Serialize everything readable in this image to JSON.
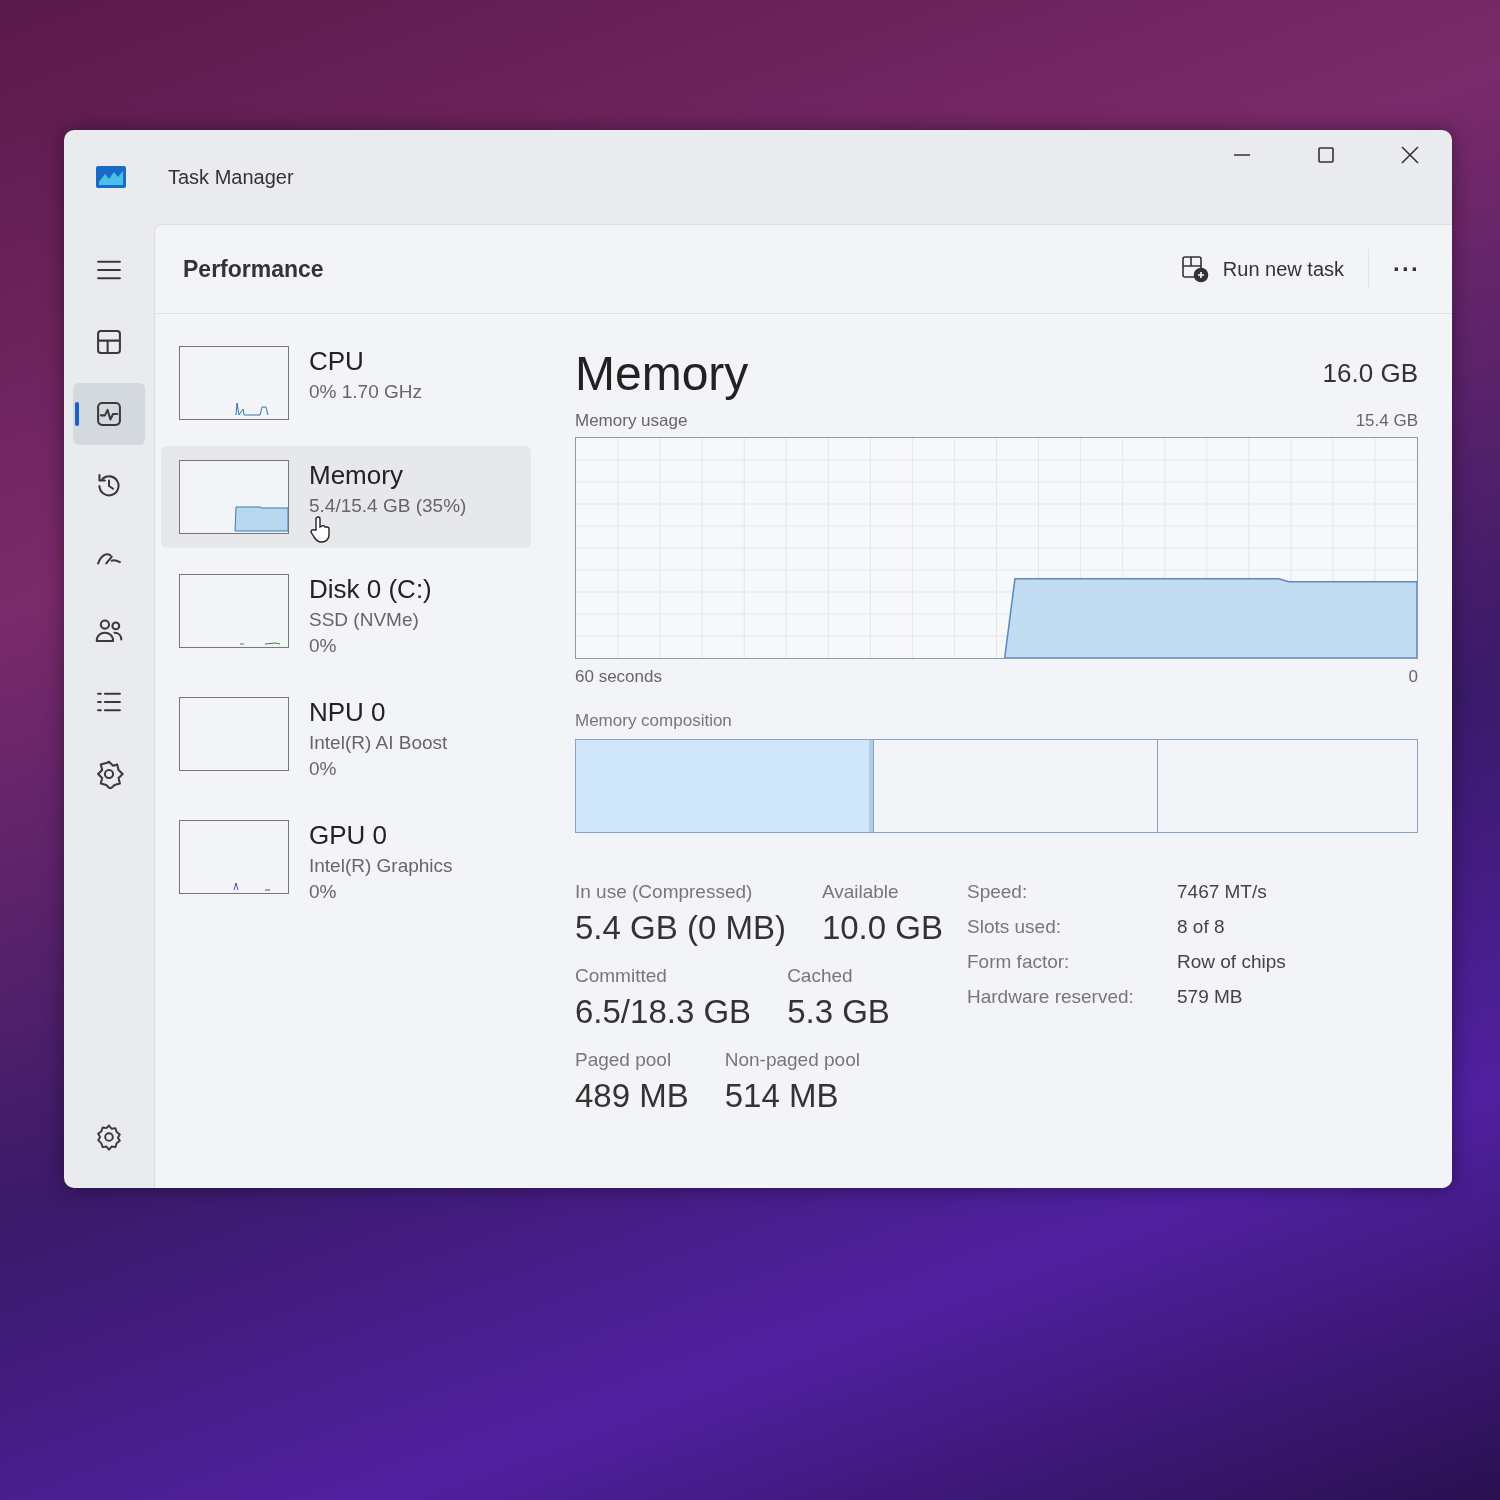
{
  "window": {
    "title": "Task Manager"
  },
  "nav_rail": [
    {
      "selected": false
    },
    {
      "selected": false
    },
    {
      "selected": true
    },
    {
      "selected": false
    },
    {
      "selected": false
    },
    {
      "selected": false
    },
    {
      "selected": false
    },
    {
      "selected": false
    }
  ],
  "header": {
    "title": "Performance",
    "run_new_task": "Run new task",
    "more": "···"
  },
  "devices": [
    {
      "name": "CPU",
      "lines": [
        "0% 1.70 GHz"
      ],
      "selected": false,
      "kind": "cpu"
    },
    {
      "name": "Memory",
      "lines": [
        "5.4/15.4 GB (35%)"
      ],
      "selected": true,
      "kind": "memory"
    },
    {
      "name": "Disk 0 (C:)",
      "lines": [
        "SSD (NVMe)",
        "0%"
      ],
      "selected": false,
      "kind": "disk"
    },
    {
      "name": "NPU 0",
      "lines": [
        "Intel(R) AI Boost",
        "0%"
      ],
      "selected": false,
      "kind": "npu"
    },
    {
      "name": "GPU 0",
      "lines": [
        "Intel(R) Graphics",
        "0%"
      ],
      "selected": false,
      "kind": "gpu"
    }
  ],
  "detail": {
    "title": "Memory",
    "total": "16.0 GB",
    "usage_label": "Memory usage",
    "usage_max": "15.4 GB",
    "time_start": "60 seconds",
    "time_end": "0",
    "composition_label": "Memory composition",
    "stats": [
      [
        {
          "label": "In use (Compressed)",
          "value": "5.4 GB (0 MB)"
        },
        {
          "label": "Available",
          "value": "10.0 GB"
        }
      ],
      [
        {
          "label": "Committed",
          "value": "6.5/18.3 GB"
        },
        {
          "label": "Cached",
          "value": "5.3 GB"
        }
      ],
      [
        {
          "label": "Paged pool",
          "value": "489 MB"
        },
        {
          "label": "Non-paged pool",
          "value": "514 MB"
        }
      ]
    ],
    "properties": [
      {
        "label": "Speed:",
        "value": "7467 MT/s"
      },
      {
        "label": "Slots used:",
        "value": "8 of 8"
      },
      {
        "label": "Form factor:",
        "value": "Row of chips"
      },
      {
        "label": "Hardware reserved:",
        "value": "579 MB"
      }
    ]
  }
}
